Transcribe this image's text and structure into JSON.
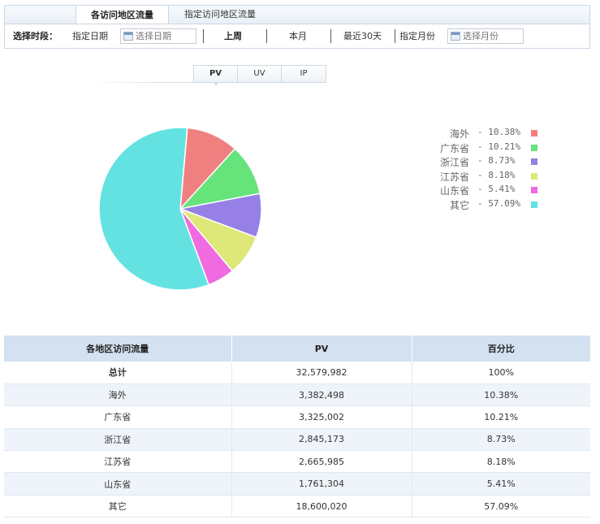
{
  "tabs": {
    "active_label": "各访问地区流量",
    "inactive_label": "指定访问地区流量"
  },
  "filter": {
    "period_label": "选择时段：",
    "specified_date": "指定日期",
    "date_placeholder": "选择日期",
    "last_week": "上周",
    "this_month": "本月",
    "last_30_days": "最近30天",
    "specified_month": "指定月份",
    "month_placeholder": "选择月份"
  },
  "metric_tabs": [
    "PV",
    "UV",
    "IP"
  ],
  "chart_data": {
    "type": "pie",
    "slices": [
      {
        "label": "海外",
        "percent": 10.38,
        "color": "#f08080"
      },
      {
        "label": "广东省",
        "percent": 10.21,
        "color": "#66e37a"
      },
      {
        "label": "浙江省",
        "percent": 8.73,
        "color": "#9680e6"
      },
      {
        "label": "江苏省",
        "percent": 8.18,
        "color": "#dde878"
      },
      {
        "label": "山东省",
        "percent": 5.41,
        "color": "#f06ae0"
      },
      {
        "label": "其它",
        "percent": 57.09,
        "color": "#64e2e2"
      }
    ],
    "legend_placement": "right",
    "legend_pct_text": [
      "- 10.38%",
      "- 10.21%",
      "- 8.73%",
      "- 8.18%",
      "- 5.41%",
      "- 57.09%"
    ]
  },
  "table": {
    "headers": [
      "各地区访问流量",
      "PV",
      "百分比"
    ],
    "rows": [
      {
        "name": "总计",
        "pv": "32,579,982",
        "pct": "100%"
      },
      {
        "name": "海外",
        "pv": "3,382,498",
        "pct": "10.38%"
      },
      {
        "name": "广东省",
        "pv": "3,325,002",
        "pct": "10.21%"
      },
      {
        "name": "浙江省",
        "pv": "2,845,173",
        "pct": "8.73%"
      },
      {
        "name": "江苏省",
        "pv": "2,665,985",
        "pct": "8.18%"
      },
      {
        "name": "山东省",
        "pv": "1,761,304",
        "pct": "5.41%"
      },
      {
        "name": "其它",
        "pv": "18,600,020",
        "pct": "57.09%"
      }
    ]
  }
}
